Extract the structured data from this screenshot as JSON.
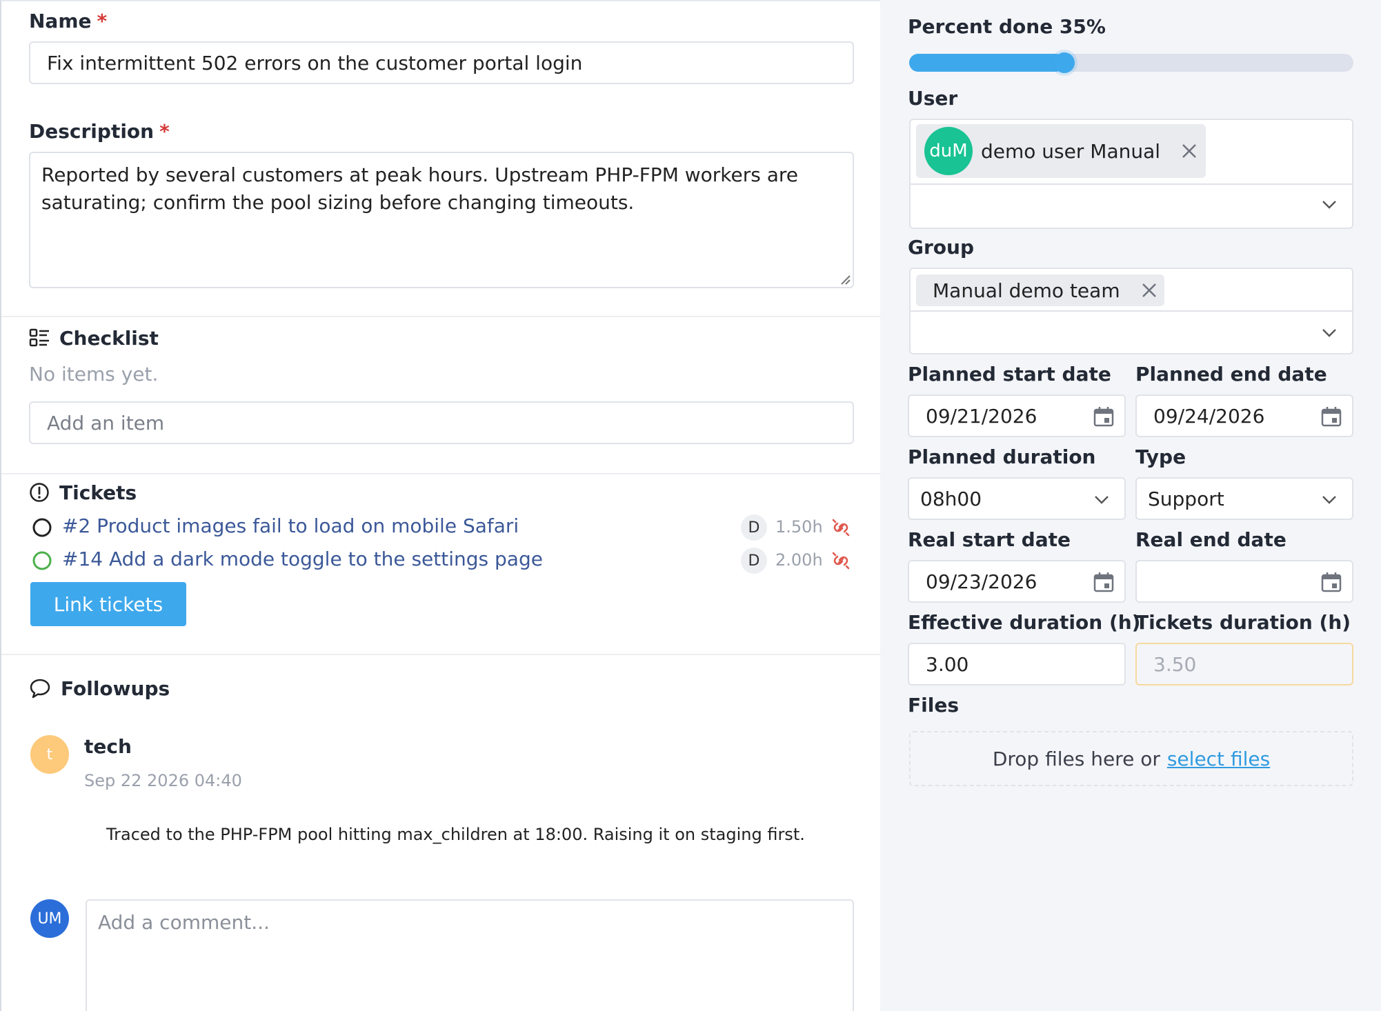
{
  "form": {
    "name_label": "Name",
    "required_mark": "*",
    "name_value": "Fix intermittent 502 errors on the customer portal login",
    "description_label": "Description",
    "description_value": "Reported by several customers at peak hours. Upstream PHP-FPM workers are saturating; confirm the pool sizing before changing timeouts."
  },
  "checklist": {
    "title": "Checklist",
    "empty_text": "No items yet.",
    "add_placeholder": "Add an item"
  },
  "tickets": {
    "title": "Tickets",
    "items": [
      {
        "label": "#2 Product images fail to load on mobile Safari",
        "badge": "D",
        "duration": "1.50h",
        "status_color": "#222222"
      },
      {
        "label": "#14 Add a dark mode toggle to the settings page",
        "badge": "D",
        "duration": "2.00h",
        "status_color": "#4cb04c"
      }
    ],
    "link_button": "Link tickets"
  },
  "followups": {
    "title": "Followups",
    "items": [
      {
        "avatar": "t",
        "avatar_color": "#fdc97a",
        "author": "tech",
        "date": "Sep 22 2026 04:40",
        "content": "Traced to the PHP-FPM pool hitting max_children at 18:00. Raising it on staging first."
      }
    ],
    "current_user_avatar": "UM",
    "comment_placeholder": "Add a comment..."
  },
  "sidebar": {
    "percent_label": "Percent done 35%",
    "percent_value": 0.35,
    "user_label": "User",
    "user_chip": {
      "avatar": "duM",
      "name": "demo user Manual",
      "avatar_color": "#19c393"
    },
    "group_label": "Group",
    "group_chip": "Manual demo team",
    "planned_start_label": "Planned start date",
    "planned_start_value": "09/21/2026",
    "planned_end_label": "Planned end date",
    "planned_end_value": "09/24/2026",
    "planned_duration_label": "Planned duration",
    "planned_duration_value": "08h00",
    "type_label": "Type",
    "type_value": "Support",
    "real_start_label": "Real start date",
    "real_start_value": "09/23/2026",
    "real_end_label": "Real end date",
    "real_end_value": "",
    "effective_duration_label": "Effective duration (h)",
    "effective_duration_value": "3.00",
    "tickets_duration_label": "Tickets duration (h)",
    "tickets_duration_value": "3.50",
    "files_label": "Files",
    "files_drop_text": "Drop files here or",
    "files_select_link": "select files"
  },
  "colors": {
    "accent": "#3ea8ec",
    "required": "#d63939",
    "link": "#3b5898",
    "unlink": "#e0594f"
  }
}
